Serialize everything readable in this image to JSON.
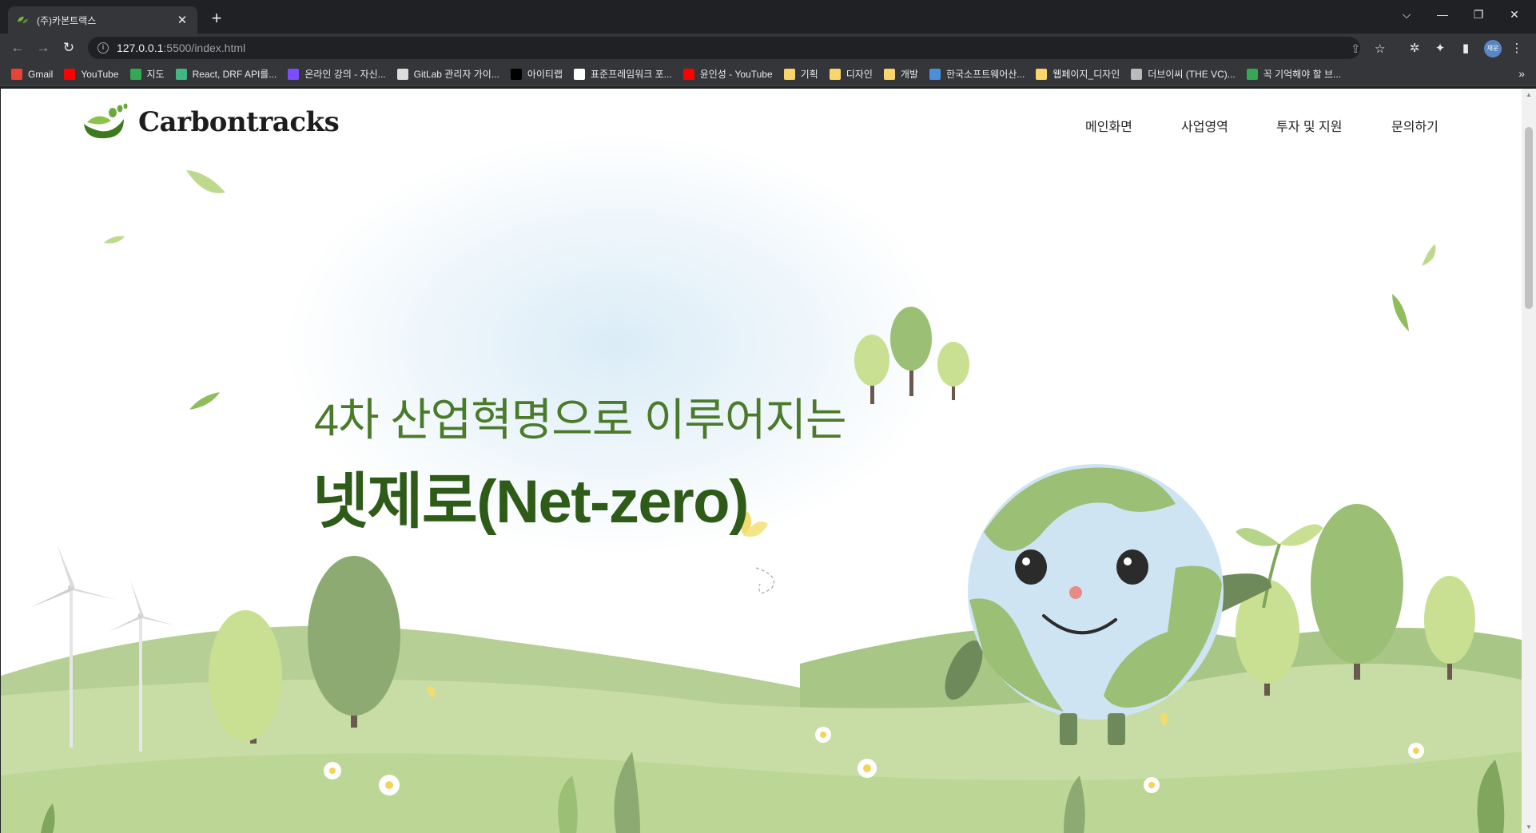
{
  "browser": {
    "tab": {
      "title": "(주)카본트랙스"
    },
    "url": {
      "host": "127.0.0.1",
      "rest": ":5500/index.html"
    },
    "bookmarks": [
      {
        "label": "Gmail",
        "color": "#ea4335"
      },
      {
        "label": "YouTube",
        "color": "#ff0000"
      },
      {
        "label": "지도",
        "color": "#34a853"
      },
      {
        "label": "React, DRF API를...",
        "color": "#41b883"
      },
      {
        "label": "온라인 강의 - 자신...",
        "color": "#7c4dff"
      },
      {
        "label": "GitLab 관리자 가이...",
        "color": "#dddddd"
      },
      {
        "label": "아이티랩",
        "color": "#000000"
      },
      {
        "label": "표준프레임워크 포...",
        "color": "#ffffff"
      },
      {
        "label": "윤인성 - YouTube",
        "color": "#ff0000"
      },
      {
        "label": "기획",
        "color": "#f9d66b"
      },
      {
        "label": "디자인",
        "color": "#f9d66b"
      },
      {
        "label": "개발",
        "color": "#f9d66b"
      },
      {
        "label": "한국소프트웨어산...",
        "color": "#4a90d9"
      },
      {
        "label": "웹페이지_디자인",
        "color": "#f9d66b"
      },
      {
        "label": "더브이씨 (THE VC)...",
        "color": "#bbbbbb"
      },
      {
        "label": "꼭 기억해야 할 브...",
        "color": "#34a853"
      }
    ],
    "profile_initials": "채운"
  },
  "site": {
    "logo_text": "Carbontracks",
    "nav": [
      "메인화면",
      "사업영역",
      "투자 및 지원",
      "문의하기"
    ],
    "hero": {
      "subtitle": "4차 산업혁명으로 이루어지는",
      "title": "넷제로(Net-zero)"
    },
    "colors": {
      "brand_green": "#2e5c18",
      "subtitle_green": "#4b7a2b",
      "hill_light": "#c9dfa8",
      "hill_mid": "#b3d08c",
      "earth_blue": "#cfe4f2",
      "earth_green": "#9cbf76"
    }
  }
}
